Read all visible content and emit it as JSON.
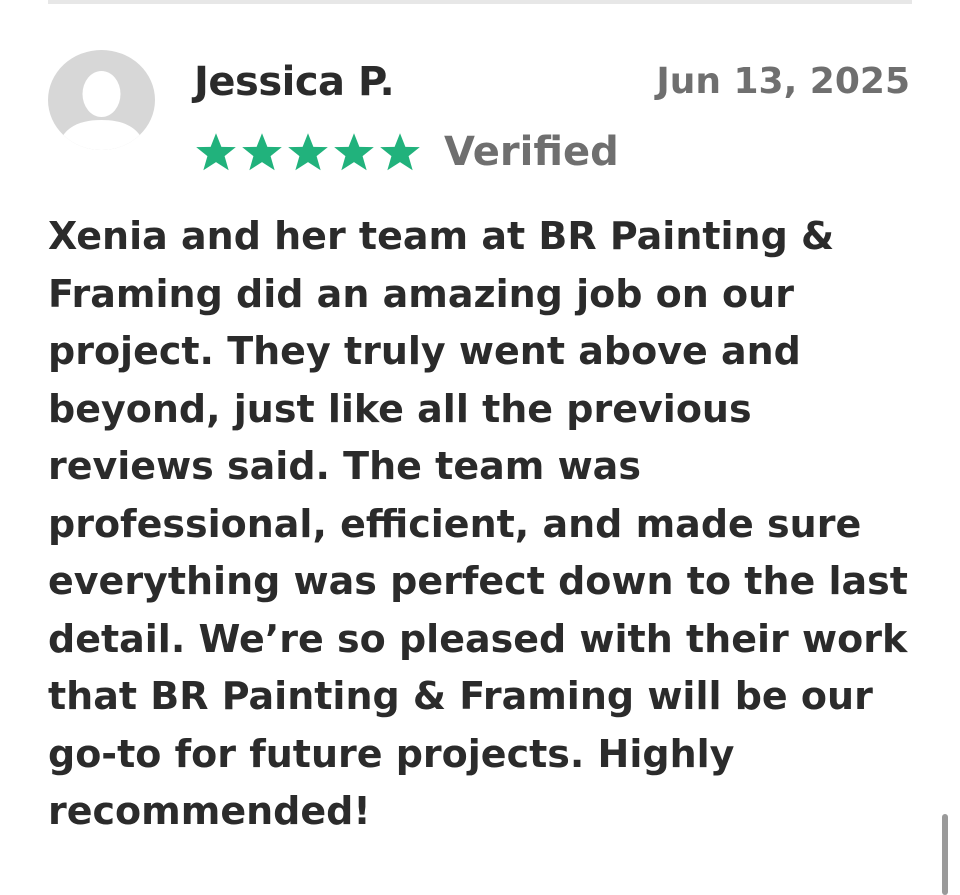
{
  "review": {
    "reviewer_name": "Jessica P.",
    "date": "Jun 13, 2025",
    "rating": 5,
    "rating_max": 5,
    "verified_label": "Verified",
    "body": "Xenia and her team at BR Painting & Framing did an amazing job on our project. They truly went above and beyond, just like all the previous reviews said. The team was professional, efficient, and made sure everything was perfect down to the last detail. We’re so pleased with their work that BR Painting & Framing will be our go-to for future projects. Highly recommended!"
  },
  "icons": {
    "avatar": "user-avatar-placeholder-icon",
    "star": "star-filled-icon"
  },
  "colors": {
    "star": "#21b27c",
    "text_primary": "#2b2b2b",
    "text_secondary": "#6f6f6f",
    "avatar_bg": "#d7d7d7",
    "avatar_fg": "#ffffff"
  }
}
